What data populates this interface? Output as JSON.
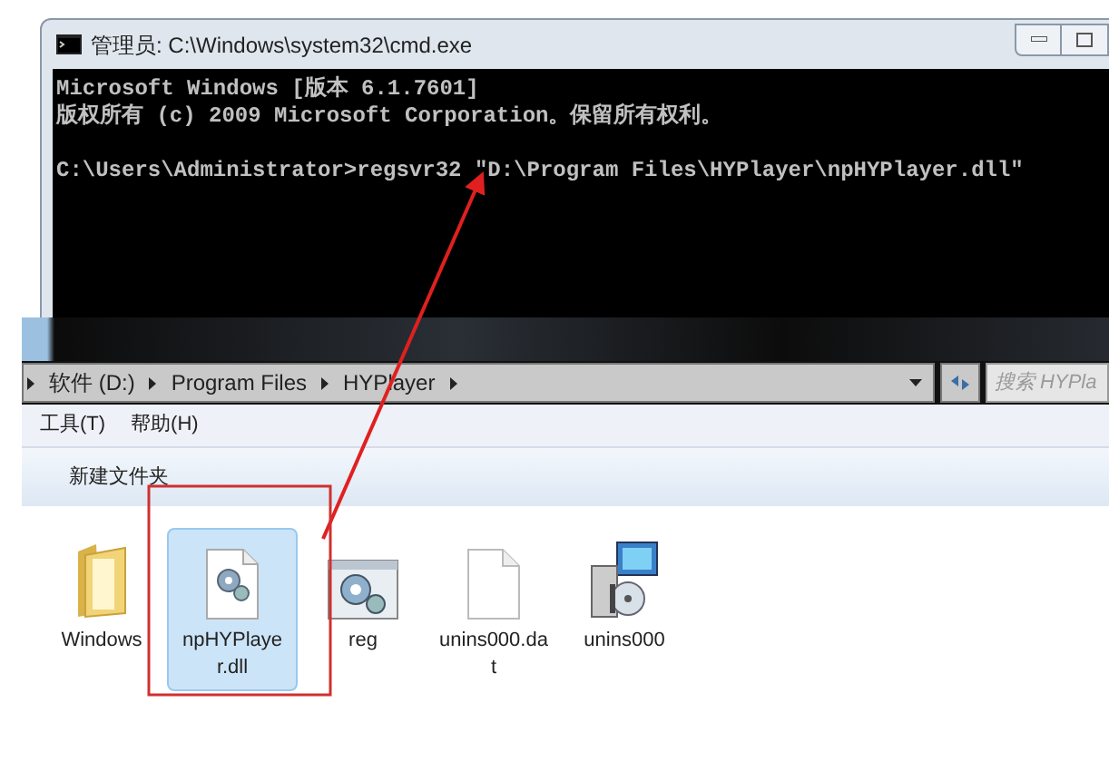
{
  "cmd_window": {
    "title": "管理员: C:\\Windows\\system32\\cmd.exe",
    "header_lines": [
      "Microsoft Windows [版本 6.1.7601]",
      "版权所有 (c) 2009 Microsoft Corporation。保留所有权利。"
    ],
    "command_line": "C:\\Users\\Administrator>regsvr32 \"D:\\Program Files\\HYPlayer\\npHYPlayer.dll\""
  },
  "explorer_window": {
    "breadcrumbs": [
      "软件 (D:)",
      "Program Files",
      "HYPlayer"
    ],
    "search": {
      "placeholder": "搜索 HYPla"
    },
    "menu": [
      "工具(T)",
      "帮助(H)"
    ],
    "toolbar": [
      "新建文件夹"
    ],
    "files": [
      {
        "name": "Windows",
        "kind": "folder",
        "selected": false
      },
      {
        "name": "npHYPlayer.dll",
        "kind": "dll",
        "selected": true
      },
      {
        "name": "reg",
        "kind": "reg",
        "selected": false
      },
      {
        "name": "unins000.dat",
        "kind": "file",
        "selected": false
      },
      {
        "name": "unins000",
        "kind": "installer",
        "selected": false
      }
    ]
  }
}
